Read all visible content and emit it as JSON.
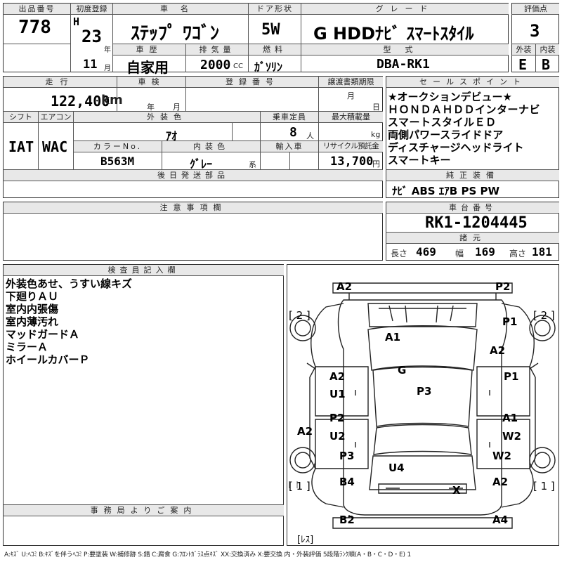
{
  "header": {
    "lot_no_label": "出品番号",
    "lot_no": "778",
    "first_reg_label": "初度登録",
    "era": "H",
    "year": "23",
    "year_unit": "年",
    "month": "11",
    "month_unit": "月",
    "car_name_label": "車名",
    "car_name": "ｽﾃｯﾌﾟ ﾜｺﾞﾝ",
    "door_label": "ドア形状",
    "door": "5W",
    "grade_label": "グレード",
    "grade": "G HDDﾅﾋﾞ ｽﾏｰﾄｽﾀｲﾙ",
    "score_label": "評価点",
    "score": "3",
    "history_label": "車歴",
    "history": "自家用",
    "displacement_label": "排気量",
    "displacement": "2000",
    "cc": "CC",
    "fuel_label": "燃料",
    "fuel": "ｶﾞｿﾘﾝ",
    "model_label": "型式",
    "model": "DBA-RK1",
    "ext_label": "外装",
    "ext_grade": "E",
    "int_label": "内装",
    "int_grade": "B"
  },
  "spec": {
    "mileage_label": "走行",
    "mileage": "122,400",
    "km": "km",
    "inspection_label": "車検",
    "insp_year": "年",
    "insp_month": "月",
    "reg_no_label": "登録番号",
    "transfer_label": "譲渡書類期限",
    "transfer_month": "月",
    "transfer_day": "日",
    "shift_label": "シフト",
    "shift": "IAT",
    "ac_label": "エアコン",
    "ac": "WAC",
    "color_label": "外装色",
    "color": "ｱｵ",
    "capacity_label": "乗車定員",
    "capacity": "8",
    "capacity_unit": "人",
    "load_label": "最大積載量",
    "load_unit": "kg",
    "colorno_label": "カラーNo.",
    "colorno": "B563M",
    "interior_label": "内装色",
    "interior": "ｸﾞﾚｰ",
    "interior_unit": "系",
    "import_label": "輸入車",
    "recycle_label": "リサイクル預託金",
    "recycle": "13,700",
    "recycle_unit": "円",
    "later_parts_label": "後日発送部品"
  },
  "sales": {
    "label": "セールスポイント",
    "lines": [
      "★オークションデビュー★",
      "ＨＯＮＤＡＨＤＤインターナビ",
      "スマートスタイルＥＤ",
      "両側パワースライドドア",
      "ディスチャージヘッドライト",
      "スマートキー"
    ]
  },
  "equipment": {
    "label": "純正装備",
    "value": "ﾅﾋﾞ ABS ｴｱB PS PW"
  },
  "chassis": {
    "label": "車台番号",
    "value": "RK1-1204445",
    "spec_label": "諸元",
    "length_label": "長さ",
    "length": "469",
    "width_label": "幅",
    "width": "169",
    "height_label": "高さ",
    "height": "181"
  },
  "notes": {
    "label": "注意事項欄"
  },
  "inspector": {
    "label": "検査員記入欄",
    "lines": [
      "外装色あせ、うすい線キズ",
      "下廻りＡＵ",
      "室内内張傷",
      "室内薄汚れ",
      "マッドガードＡ",
      "ミラーＡ",
      "ホイールカバーＰ"
    ]
  },
  "office": {
    "label": "事務局よりご案内"
  },
  "diagram": {
    "marks": [
      "A2",
      "P2",
      "[ 2 ]",
      "[ 2 ]",
      "P1",
      "A1",
      "A2",
      "G",
      "A2",
      "U1",
      "P1",
      "P3",
      "P2",
      "U2",
      "A1",
      "W2",
      "A2",
      "P3",
      "W2",
      "U4",
      "[ 1 ]",
      "B4",
      "X",
      "A2",
      "[ 1 ]",
      "B2",
      "A4",
      "[ﾚｽ]"
    ]
  },
  "legend": "A:ｷｽﾞ U:ﾍｺﾐ B:ｷｽﾞを伴うﾍｺﾐ P:要塗装 W:補修跡 S:錆 C:腐食 G:ﾌﾛﾝﾄｶﾞﾗｽ点ｷｽﾞ XX:交換済み X:要交換 内・外装評価 5段階ﾗﾝｸ順(A・B・C・D・E) 1"
}
